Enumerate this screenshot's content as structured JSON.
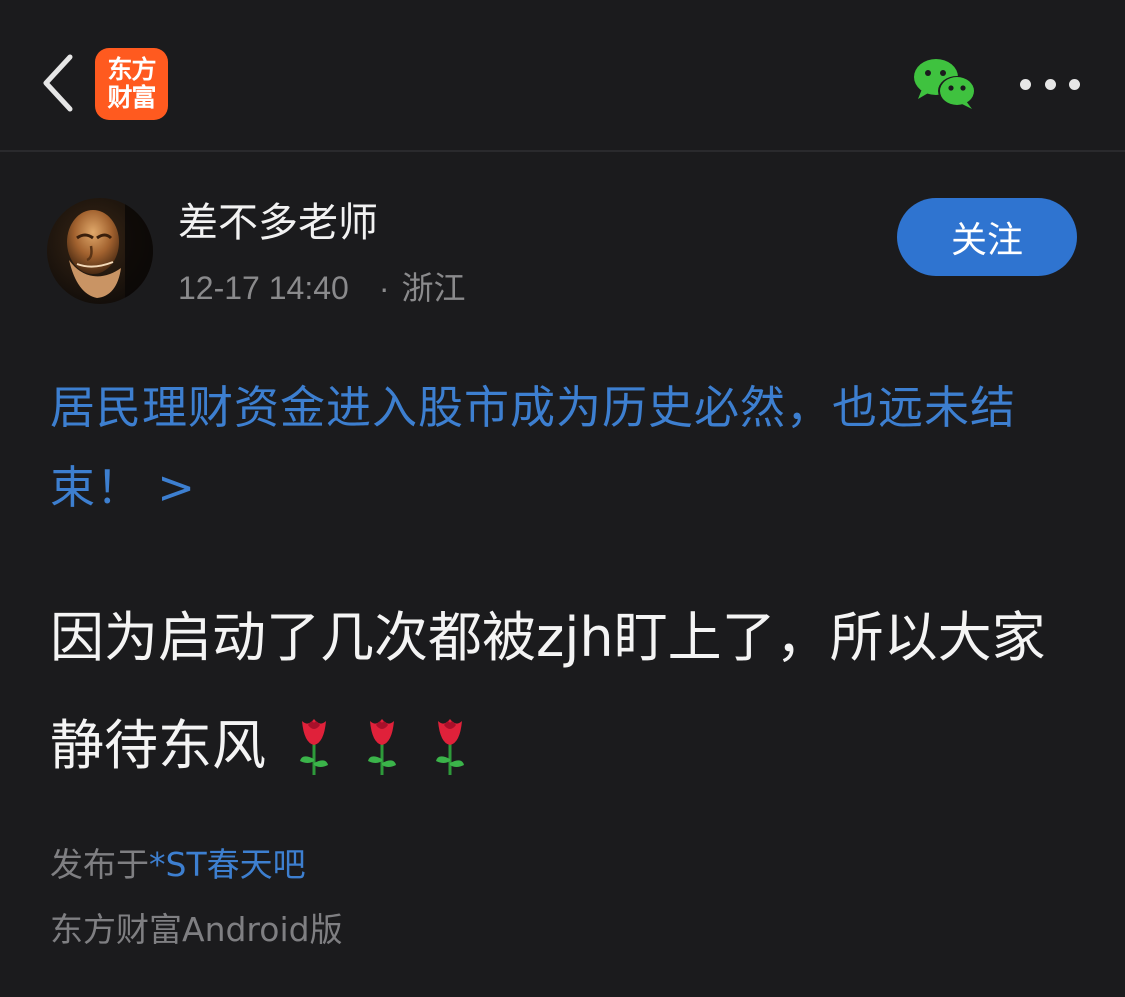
{
  "header": {
    "logo_line1": "东方",
    "logo_line2": "财富",
    "back_icon": "chevron-left-icon",
    "share_icon": "wechat-icon",
    "more_icon": "more-dots-icon",
    "brand_color": "#ff5a1f"
  },
  "author": {
    "name": "差不多老师",
    "time": "12-17 14:40",
    "separator": "·",
    "location": "浙江",
    "follow_label": "关注",
    "follow_color": "#2f74d0"
  },
  "post": {
    "title": "居民理财资金进入股市成为历史必然，也远未结束！ >",
    "body": "因为启动了几次都被zjh盯上了，所以大家静待东风",
    "emoji": [
      "rose-icon",
      "rose-icon",
      "rose-icon"
    ],
    "link_color": "#3d7fd0"
  },
  "footer": {
    "posted_prefix": "发布于",
    "bar_name": "*ST春天吧",
    "client": "东方财富Android版"
  }
}
